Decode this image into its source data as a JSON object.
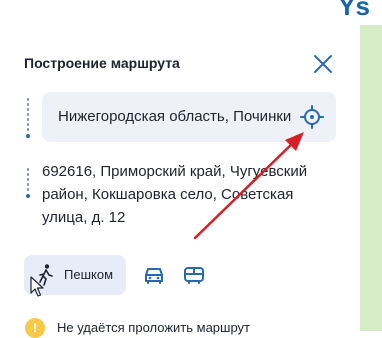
{
  "header": {
    "fragment": "Ys"
  },
  "panel": {
    "title": "Построение маршрута"
  },
  "route": {
    "from_value": "Нижегородская область, Починки",
    "to_value": "692616, Приморский край, Чугуевский район, Кокшаровка село, Советская улица, д. 12"
  },
  "modes": {
    "walk_label": "Пешком"
  },
  "warning": {
    "text": "Не удаётся проложить маршрут"
  },
  "icons": {
    "close": "close-icon",
    "target": "crosshair-icon",
    "walk": "pedestrian-icon",
    "car": "car-icon",
    "bus": "bus-icon",
    "warning": "warning-icon"
  },
  "colors": {
    "accent": "#2969b0",
    "field_bg": "#eef1f7",
    "mode_selected_bg": "#e7ecf8",
    "annotation": "#d61f26",
    "map": "#d6ecc6",
    "warning": "#f7c948"
  }
}
